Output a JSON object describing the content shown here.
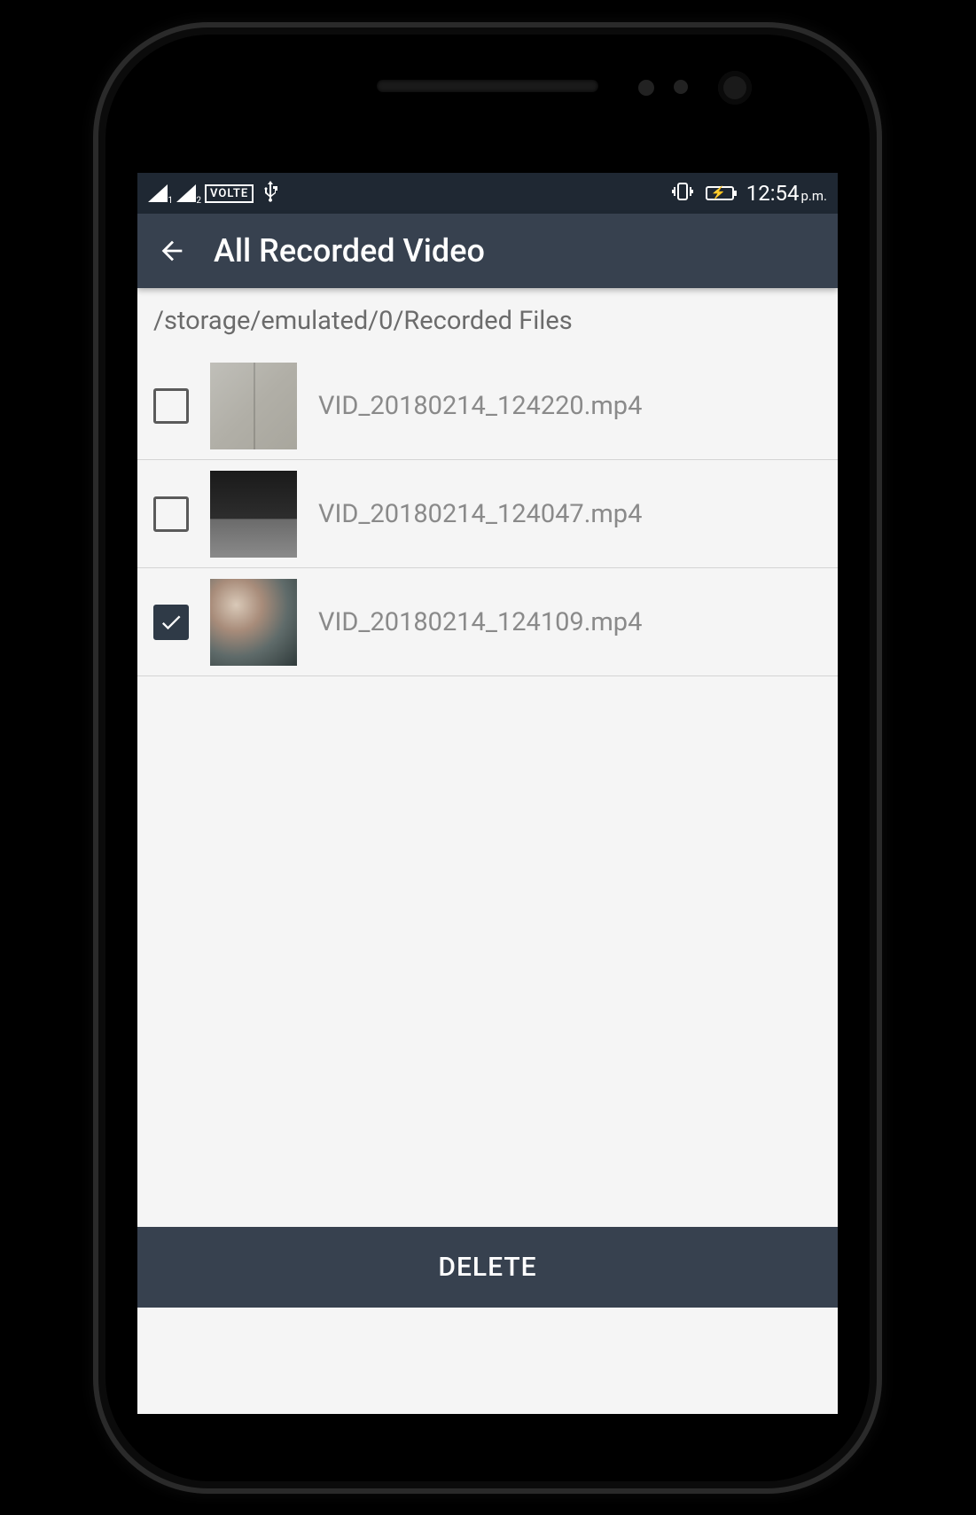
{
  "statusbar": {
    "volte": "VOLTE",
    "time": "12:54",
    "ampm": "p.m."
  },
  "appbar": {
    "title": "All Recorded Video"
  },
  "path": "/storage/emulated/0/Recorded Files",
  "files": [
    {
      "name": "VID_20180214_124220.mp4",
      "checked": false
    },
    {
      "name": "VID_20180214_124047.mp4",
      "checked": false
    },
    {
      "name": "VID_20180214_124109.mp4",
      "checked": true
    }
  ],
  "actions": {
    "delete": "DELETE"
  }
}
